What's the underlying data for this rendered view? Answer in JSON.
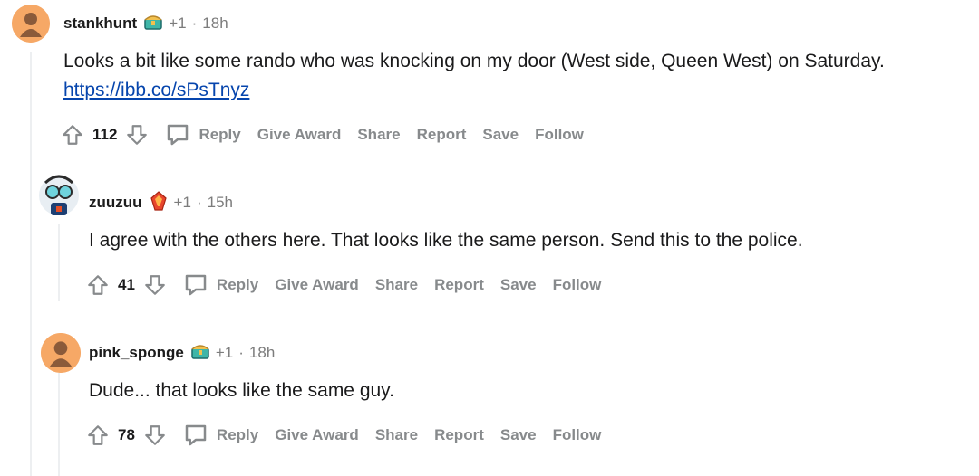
{
  "comments": [
    {
      "username": "stankhunt",
      "karma": "+1",
      "separator": "·",
      "time": "18h",
      "text": "Looks a bit like some rando who was knocking on my door (West side, Queen West) on Saturday.",
      "link": "https://ibb.co/sPsTnyz",
      "score": "112",
      "award_icon": "treasure-chest-award-icon",
      "avatar_color": "#f6a866"
    },
    {
      "username": "zuuzuu",
      "karma": "+1",
      "separator": "·",
      "time": "15h",
      "text": "I agree with the others here. That looks like the same person. Send this to the police.",
      "link": "",
      "score": "41",
      "award_icon": "fire-gem-award-icon",
      "avatar_color": "#9fb3c8"
    },
    {
      "username": "pink_sponge",
      "karma": "+1",
      "separator": "·",
      "time": "18h",
      "text": "Dude... that looks like the same guy.",
      "link": "",
      "score": "78",
      "award_icon": "treasure-chest-award-icon",
      "avatar_color": "#f6a866"
    }
  ],
  "actions": {
    "reply": "Reply",
    "give_award": "Give Award",
    "share": "Share",
    "report": "Report",
    "save": "Save",
    "follow": "Follow"
  }
}
